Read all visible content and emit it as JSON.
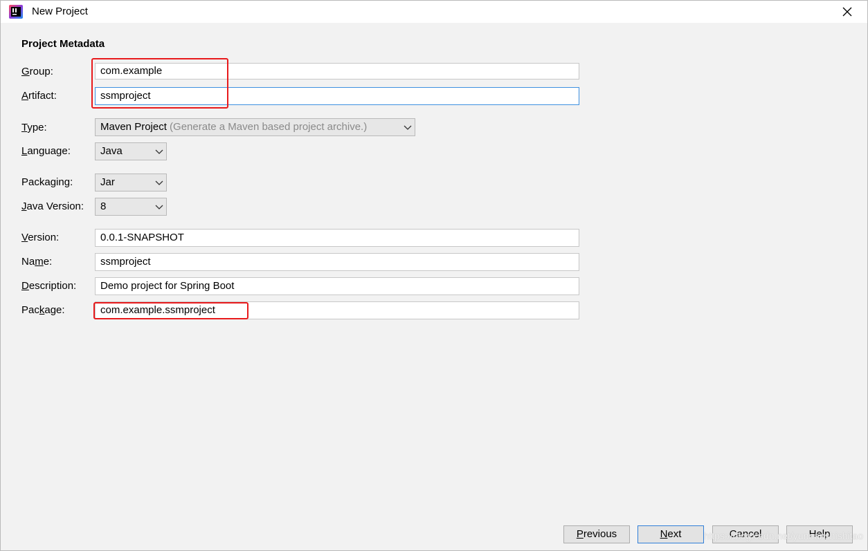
{
  "window": {
    "title": "New Project",
    "icon": "intellij-idea-icon",
    "close_icon": "close-icon"
  },
  "section": {
    "title": "Project Metadata"
  },
  "labels": {
    "group": {
      "mnemonic": "G",
      "rest": "roup:"
    },
    "artifact": {
      "mnemonic": "A",
      "rest": "rtifact:"
    },
    "type": {
      "mnemonic": "T",
      "rest": "ype:"
    },
    "language": {
      "mnemonic": "L",
      "rest": "anguage:"
    },
    "packaging": {
      "pre": "Packa",
      "mnemonic": "g",
      "rest": "ing:"
    },
    "java_version": {
      "mnemonic": "J",
      "rest": "ava Version:"
    },
    "version": {
      "mnemonic": "V",
      "rest": "ersion:"
    },
    "name": {
      "pre": "Na",
      "mnemonic": "m",
      "rest": "e:"
    },
    "description": {
      "mnemonic": "D",
      "rest": "escription:"
    },
    "package": {
      "pre": "Pac",
      "mnemonic": "k",
      "rest": "age:"
    }
  },
  "fields": {
    "group": "com.example",
    "artifact": "ssmproject",
    "version": "0.0.1-SNAPSHOT",
    "name": "ssmproject",
    "description": "Demo project for Spring Boot",
    "package": "com.example.ssmproject"
  },
  "selects": {
    "type": {
      "value": "Maven Project",
      "hint": "(Generate a Maven based project archive.)"
    },
    "language": {
      "value": "Java"
    },
    "packaging": {
      "value": "Jar"
    },
    "java_version": {
      "value": "8"
    }
  },
  "buttons": {
    "previous": {
      "mnemonic": "P",
      "rest": "revious"
    },
    "next": {
      "mnemonic": "N",
      "rest": "ext"
    },
    "cancel": {
      "label": "Cancel"
    },
    "help": {
      "label": "Help"
    }
  },
  "watermark": "https://blog.csdn.net/yunnanshishitao",
  "colors": {
    "highlight": "#e8191b",
    "focus_border": "#3c8fe0",
    "background": "#f2f2f2"
  }
}
